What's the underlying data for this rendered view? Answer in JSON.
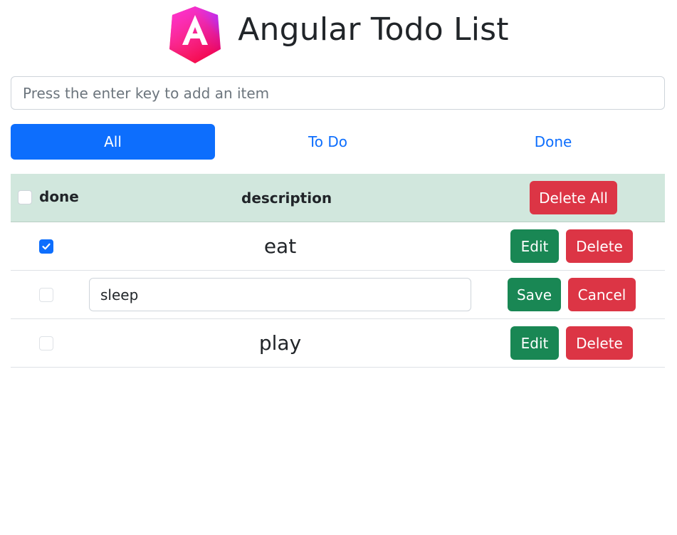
{
  "app": {
    "title": "Angular Todo List",
    "logo_icon": "angular-logo-icon"
  },
  "add_item": {
    "value": "",
    "placeholder": "Press the enter key to add an item"
  },
  "filters": {
    "selected": "All",
    "tabs": [
      {
        "label": "All"
      },
      {
        "label": "To Do"
      },
      {
        "label": "Done"
      }
    ]
  },
  "table": {
    "headers": {
      "done": "done",
      "description": "description"
    },
    "delete_all_label": "Delete All",
    "rows": [
      {
        "done": true,
        "description": "eat",
        "editing": false,
        "primary_action": "Edit",
        "secondary_action": "Delete"
      },
      {
        "done": false,
        "description": "sleep",
        "editing": true,
        "primary_action": "Save",
        "secondary_action": "Cancel"
      },
      {
        "done": false,
        "description": "play",
        "editing": false,
        "primary_action": "Edit",
        "secondary_action": "Delete"
      }
    ]
  },
  "colors": {
    "primary": "#0d6efd",
    "success": "#198754",
    "danger": "#dc3545",
    "header_bg": "#d1e7dd",
    "logo_gradient_start": "#e40035",
    "logo_gradient_end": "#7b2ff7"
  }
}
